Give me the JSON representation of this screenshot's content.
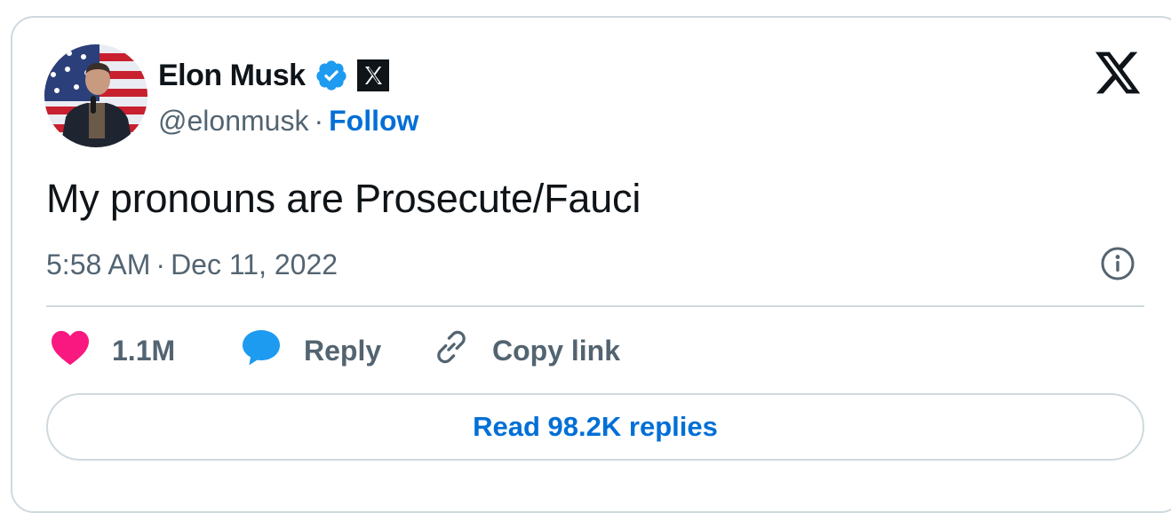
{
  "author": {
    "name": "Elon Musk",
    "handle": "@elonmusk",
    "separator": "·",
    "follow_label": "Follow",
    "verified_badge": "verified-badge-icon",
    "affiliate_badge": "x-affiliate-icon"
  },
  "tweet": {
    "text": "My pronouns are Prosecute/Fauci",
    "time": "5:58 AM",
    "date": "Dec 11, 2022",
    "separator": "·"
  },
  "actions": {
    "likes": "1.1M",
    "reply_label": "Reply",
    "copy_label": "Copy link"
  },
  "read_replies_label": "Read 98.2K replies",
  "icons": {
    "brand": "x-logo-icon",
    "info": "info-icon",
    "like": "heart-icon",
    "reply": "speech-bubble-icon",
    "copy": "link-icon"
  },
  "colors": {
    "link": "#006fd6",
    "verified": "#1d9bf0",
    "heart": "#f91880",
    "text": "#0f1419",
    "muted": "#536471",
    "border": "#cfd9de"
  }
}
